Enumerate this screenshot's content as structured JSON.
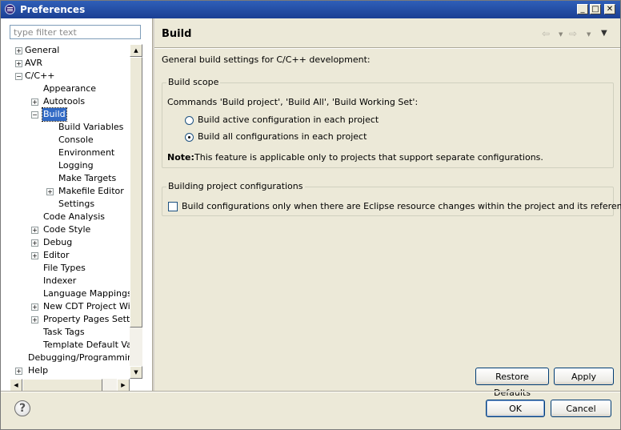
{
  "window": {
    "title": "Preferences",
    "minimize_glyph": "_",
    "maximize_glyph": "□",
    "close_glyph": "✕"
  },
  "sidebar": {
    "filter_placeholder": "type filter text",
    "tree": [
      {
        "label": "General",
        "expander": "+"
      },
      {
        "label": "AVR",
        "expander": "+"
      },
      {
        "label": "C/C++",
        "expander": "−"
      },
      {
        "label": "Appearance",
        "expander": ""
      },
      {
        "label": "Autotools",
        "expander": "+"
      },
      {
        "label": "Build",
        "expander": "−"
      },
      {
        "label": "Build Variables",
        "expander": ""
      },
      {
        "label": "Console",
        "expander": ""
      },
      {
        "label": "Environment",
        "expander": ""
      },
      {
        "label": "Logging",
        "expander": ""
      },
      {
        "label": "Make Targets",
        "expander": ""
      },
      {
        "label": "Makefile Editor",
        "expander": "+"
      },
      {
        "label": "Settings",
        "expander": ""
      },
      {
        "label": "Code Analysis",
        "expander": ""
      },
      {
        "label": "Code Style",
        "expander": "+"
      },
      {
        "label": "Debug",
        "expander": "+"
      },
      {
        "label": "Editor",
        "expander": "+"
      },
      {
        "label": "File Types",
        "expander": ""
      },
      {
        "label": "Indexer",
        "expander": ""
      },
      {
        "label": "Language Mappings",
        "expander": ""
      },
      {
        "label": "New CDT Project Wizard",
        "expander": "+"
      },
      {
        "label": "Property Pages Settings",
        "expander": "+"
      },
      {
        "label": "Task Tags",
        "expander": ""
      },
      {
        "label": "Template Default Values",
        "expander": ""
      },
      {
        "label": "Debugging/Programming",
        "expander": ""
      },
      {
        "label": "Help",
        "expander": "+"
      }
    ],
    "scroll_up_glyph": "▲",
    "scroll_down_glyph": "▼",
    "scroll_left_glyph": "◀",
    "scroll_right_glyph": "▶"
  },
  "page": {
    "title": "Build",
    "nav_back_glyph": "⇦",
    "nav_forward_glyph": "⇨",
    "dropdown_glyph": "▼",
    "description": "General build settings for C/C++ development:",
    "build_scope": {
      "legend": "Build scope",
      "commands": "Commands 'Build project', 'Build All', 'Build Working Set':",
      "option_active": "Build active configuration in each project",
      "option_all": "Build all configurations in each project",
      "note_label": "Note:",
      "note_text": "This feature is applicable only to projects that support separate configurations."
    },
    "building_configs": {
      "legend": "Building project configurations",
      "checkbox_label": "Build configurations only when there are Eclipse resource changes within the project and its references"
    },
    "restore_defaults": "Restore Defaults",
    "apply": "Apply"
  },
  "footer": {
    "help_glyph": "?",
    "ok": "OK",
    "cancel": "Cancel"
  }
}
